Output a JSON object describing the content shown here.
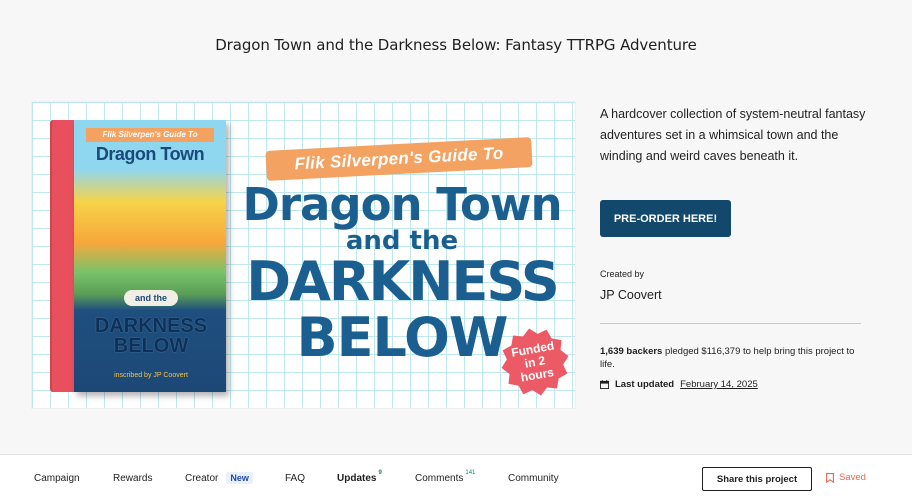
{
  "project": {
    "title": "Dragon Town and the Darkness Below: Fantasy TTRPG Adventure",
    "blurb": "A hardcover collection of system-neutral fantasy adventures set in a whimsical town and the winding and weird caves beneath it."
  },
  "hero": {
    "cover_banner": "Flik Silverpen's Guide To",
    "cover_title": "Dragon Town",
    "cover_and": "and the",
    "cover_darkness": "DARKNESS BELOW",
    "cover_author": "inscribed by JP Coovert",
    "ribbon": "Flik Silverpen's Guide To",
    "title_line1": "Dragon Town",
    "title_line2": "and the",
    "title_line3": "DARKNESS",
    "title_line4": "BELOW",
    "badge": "Funded in 2 hours"
  },
  "actions": {
    "preorder_label": "PRE-ORDER HERE!"
  },
  "creator": {
    "label": "Created by",
    "name": "JP Coovert"
  },
  "stats": {
    "backers": "1,639 backers",
    "pledged_text": " pledged $116,379 to help bring this project to life.",
    "last_updated_label": "Last updated",
    "last_updated_date": "February 14, 2025"
  },
  "nav": {
    "campaign": "Campaign",
    "rewards": "Rewards",
    "creator": "Creator",
    "creator_badge": "New",
    "faq": "FAQ",
    "updates": "Updates",
    "updates_count": "9",
    "comments": "Comments",
    "comments_count": "141",
    "community": "Community",
    "share": "Share this project",
    "saved": "Saved"
  },
  "colors": {
    "primary_button": "#12486b",
    "title_blue": "#1a5f8f",
    "badge_red": "#ec5b65",
    "saved_red": "#e26b55",
    "count_green": "#0b8a5c"
  }
}
